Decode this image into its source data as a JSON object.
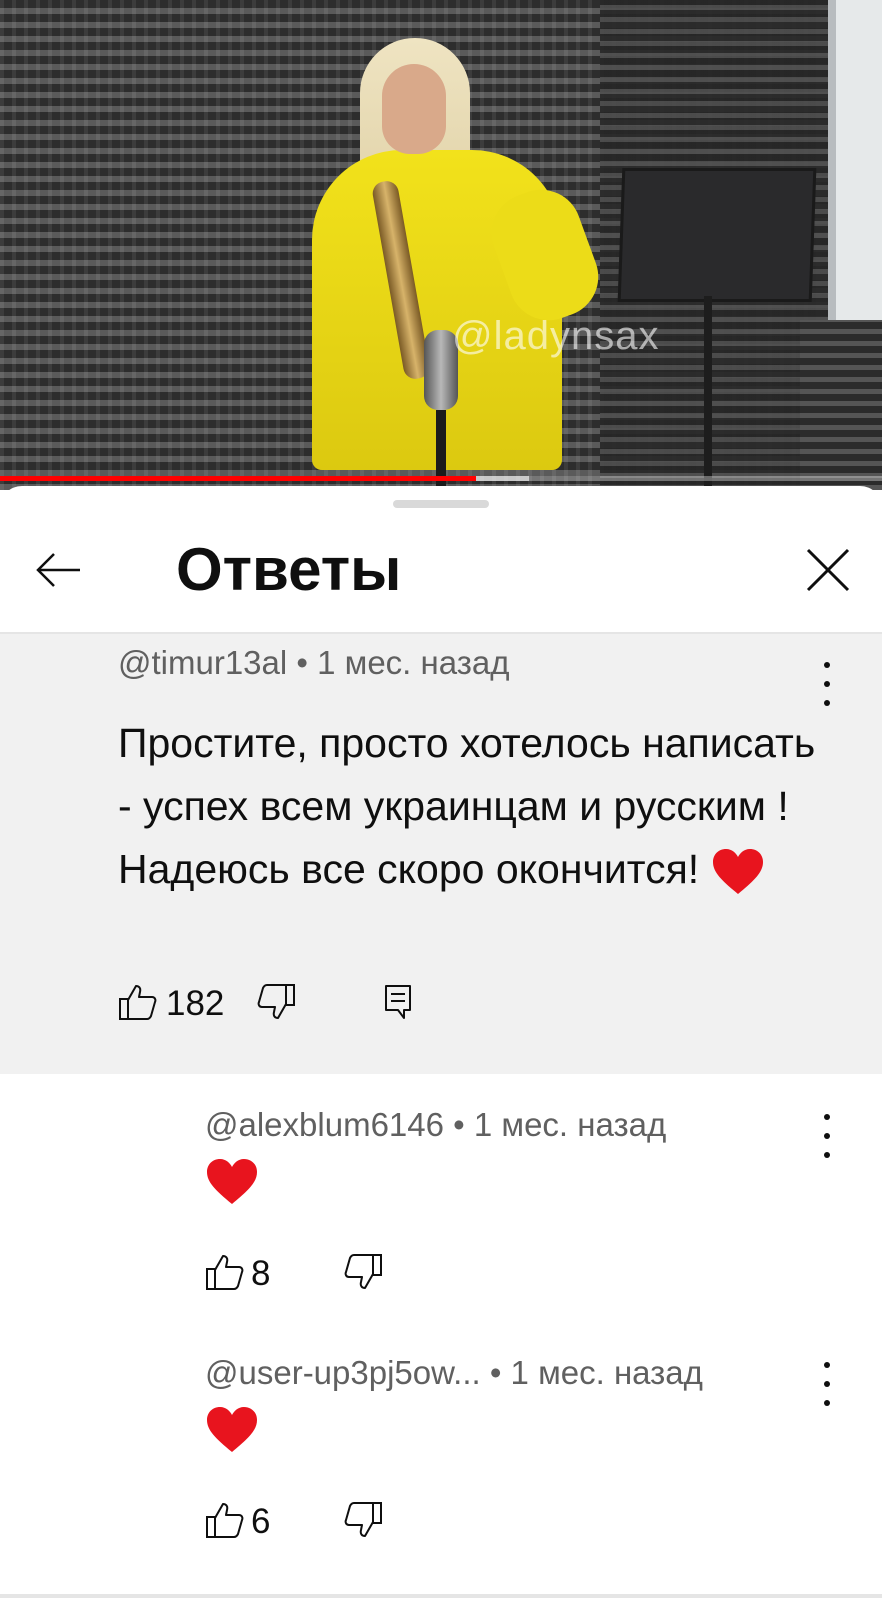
{
  "video": {
    "watermark": "@ladynsax",
    "progress": 0.54,
    "buffered": 0.6
  },
  "header": {
    "title": "Ответы",
    "back_icon": "arrow-left-icon",
    "close_icon": "close-icon"
  },
  "parent_comment": {
    "author": "@timur13al",
    "separator": " • ",
    "time": "1 мес. назад",
    "text": "Простите, просто хотелось написать - успех всем украинцам и русским ! Надеюсь все скоро окончится!",
    "emoji": "heart",
    "likes": "182",
    "icons": [
      "thumb-up-icon",
      "thumb-down-icon",
      "reply-icon"
    ]
  },
  "replies": [
    {
      "author": "@alexblum6146",
      "separator": " • ",
      "time": "1 мес. назад",
      "emoji": "heart",
      "likes": "8"
    },
    {
      "author": "@user-up3pj5ow...",
      "separator": " • ",
      "time": "1 мес. назад",
      "emoji": "heart",
      "likes": "6"
    }
  ],
  "colors": {
    "accent": "#ff0000",
    "heart": "#e8141e",
    "highlight_bg": "#f1f1f1",
    "meta_text": "#606060"
  }
}
